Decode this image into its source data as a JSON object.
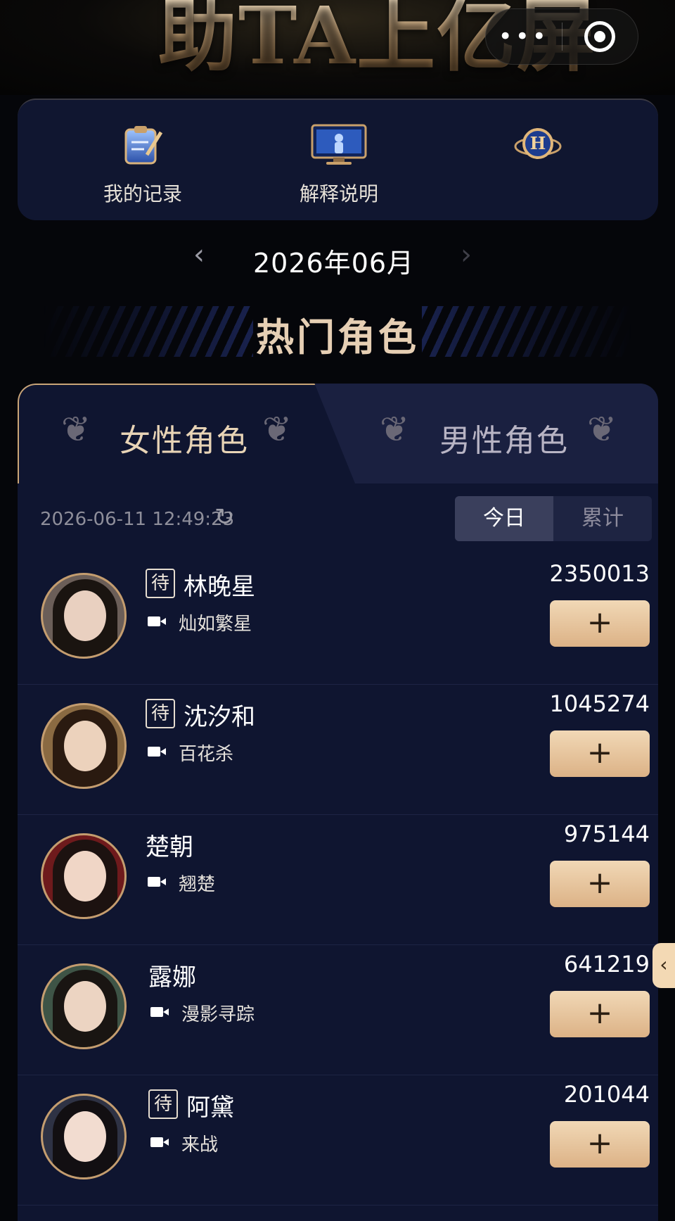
{
  "header": {
    "title": "助TA上亿屏"
  },
  "capsule": {
    "more": "•••"
  },
  "menu": {
    "items": [
      {
        "label": "我的记录",
        "icon": "record-clipboard-icon"
      },
      {
        "label": "解释说明",
        "icon": "monitor-icon"
      },
      {
        "label": "",
        "icon": "h-badge-icon"
      }
    ]
  },
  "month": {
    "label": "2026年06月",
    "prev": "‹",
    "next": "›"
  },
  "section": {
    "title": "热门角色"
  },
  "tabs": {
    "female": "女性角色",
    "male": "男性角色"
  },
  "meta": {
    "timestamp": "2026-06-11 12:49:23",
    "refresh": "↻"
  },
  "toggle": {
    "today": "今日",
    "total": "累计"
  },
  "rows": [
    {
      "badge": "待",
      "name": "林晚星",
      "show": "灿如繁星",
      "count": "2350013",
      "plus": "+",
      "avatar_color": "#d9b9a4"
    },
    {
      "badge": "待",
      "name": "沈汐和",
      "show": "百花杀",
      "count": "1045274",
      "plus": "+",
      "avatar_color": "#caa070"
    },
    {
      "badge": "",
      "name": "楚朝",
      "show": "翘楚",
      "count": "975144",
      "plus": "+",
      "avatar_color": "#7a1e1e"
    },
    {
      "badge": "",
      "name": "露娜",
      "show": "漫影寻踪",
      "count": "641219",
      "plus": "+",
      "avatar_color": "#3f5548"
    },
    {
      "badge": "待",
      "name": "阿黛",
      "show": "来战",
      "count": "201044",
      "plus": "+",
      "avatar_color": "#2e3244"
    }
  ],
  "side_tab": {
    "label": "‹"
  }
}
